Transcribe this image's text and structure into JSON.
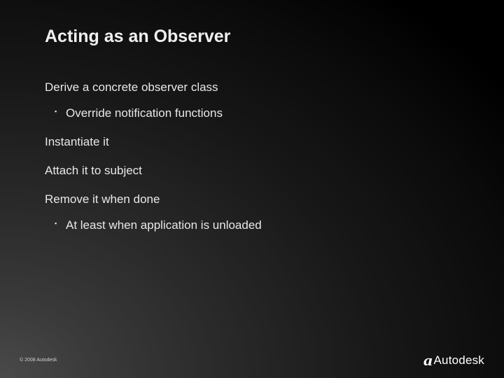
{
  "title": "Acting as an Observer",
  "body": {
    "item1": "Derive a concrete observer class",
    "item1_sub1": "Override notification functions",
    "item2": "Instantiate it",
    "item3": "Attach it to subject",
    "item4": "Remove it when done",
    "item4_sub1": "At least when application is unloaded"
  },
  "footer": "© 2008 Autodesk",
  "logo": {
    "mark": "a",
    "text": "Autodesk"
  }
}
